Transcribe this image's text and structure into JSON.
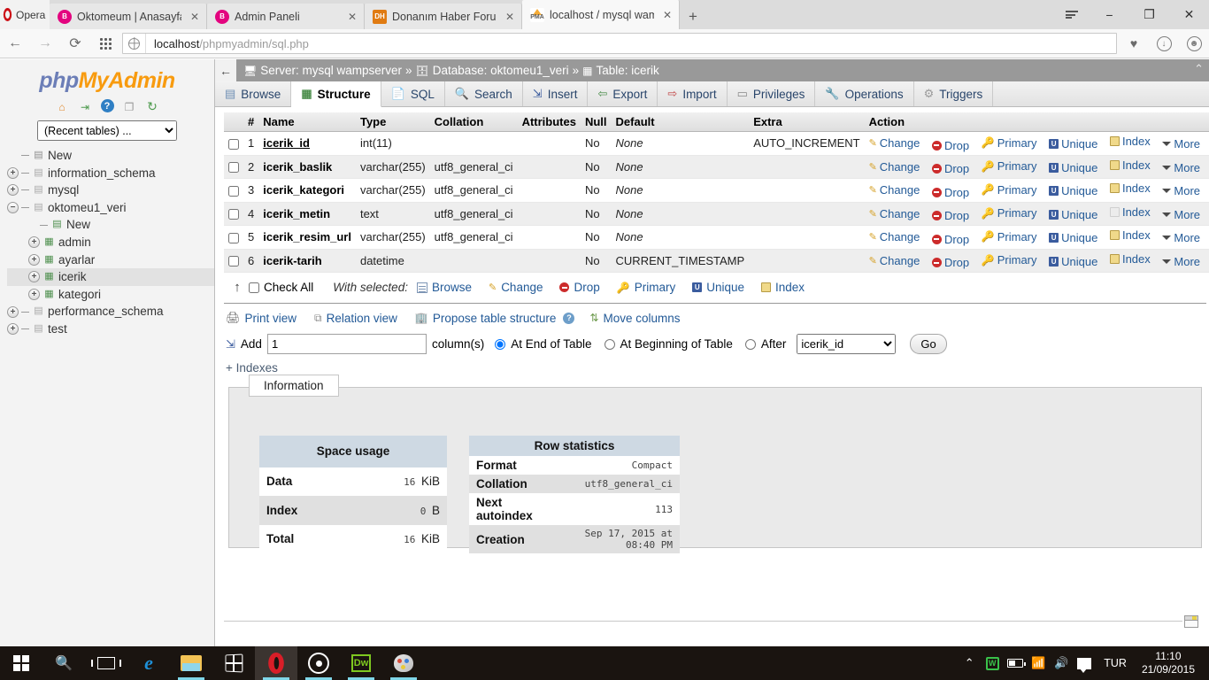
{
  "browser": {
    "brand": "Opera",
    "tabs": [
      {
        "title": "Oktomeum | Anasayfa",
        "favicon": "opera-blogger-icon",
        "active": false
      },
      {
        "title": "Admin Paneli",
        "favicon": "opera-blogger-icon",
        "active": false
      },
      {
        "title": "Donanım Haber Forum",
        "favicon": "donanim-haber-icon",
        "active": false
      },
      {
        "title": "localhost / mysql wampse",
        "favicon": "phpmyadmin-icon",
        "active": true
      }
    ],
    "new_tab_label": "+",
    "window_controls": {
      "minimize": "−",
      "maximize": "❐",
      "close": "✕"
    },
    "url_prefix": "localhost",
    "url_suffix": "/phpmyadmin/sql.php"
  },
  "sidebar": {
    "logo": {
      "php": "php",
      "my": "My",
      "admin": "Admin"
    },
    "icons": [
      {
        "name": "home-icon",
        "glyph": "⌂"
      },
      {
        "name": "logout-icon",
        "glyph": "⇥"
      },
      {
        "name": "help-icon",
        "glyph": "?"
      },
      {
        "name": "docs-icon",
        "glyph": "❐"
      },
      {
        "name": "reload-icon",
        "glyph": "↻"
      }
    ],
    "recent_select": "(Recent tables) ...",
    "tree": [
      {
        "label": "New",
        "level": 0,
        "expander": "",
        "icon": "new-db-icon",
        "selected": false
      },
      {
        "label": "information_schema",
        "level": 0,
        "expander": "+",
        "icon": "db-icon",
        "selected": false
      },
      {
        "label": "mysql",
        "level": 0,
        "expander": "+",
        "icon": "db-icon",
        "selected": false
      },
      {
        "label": "oktomeu1_veri",
        "level": 0,
        "expander": "−",
        "icon": "db-icon",
        "selected": false
      },
      {
        "label": "New",
        "level": 1,
        "expander": "",
        "icon": "new-table-icon",
        "selected": false
      },
      {
        "label": "admin",
        "level": 1,
        "expander": "+",
        "icon": "table-icon",
        "selected": false
      },
      {
        "label": "ayarlar",
        "level": 1,
        "expander": "+",
        "icon": "table-icon",
        "selected": false
      },
      {
        "label": "icerik",
        "level": 1,
        "expander": "+",
        "icon": "table-icon",
        "selected": true
      },
      {
        "label": "kategori",
        "level": 1,
        "expander": "+",
        "icon": "table-icon",
        "selected": false
      },
      {
        "label": "performance_schema",
        "level": 0,
        "expander": "+",
        "icon": "db-icon",
        "selected": false
      },
      {
        "label": "test",
        "level": 0,
        "expander": "+",
        "icon": "db-icon",
        "selected": false
      }
    ]
  },
  "breadcrumb": {
    "back": "←",
    "server_label": "Server: mysql wampserver",
    "sep": "»",
    "database_label": "Database: oktomeu1_veri",
    "table_label": "Table: icerik",
    "collapse": "⌃"
  },
  "main_tabs": [
    {
      "label": "Browse",
      "icon": "browse-icon",
      "active": false
    },
    {
      "label": "Structure",
      "icon": "structure-icon",
      "active": true
    },
    {
      "label": "SQL",
      "icon": "sql-icon",
      "active": false
    },
    {
      "label": "Search",
      "icon": "search-icon",
      "active": false
    },
    {
      "label": "Insert",
      "icon": "insert-icon",
      "active": false
    },
    {
      "label": "Export",
      "icon": "export-icon",
      "active": false
    },
    {
      "label": "Import",
      "icon": "import-icon",
      "active": false
    },
    {
      "label": "Privileges",
      "icon": "privileges-icon",
      "active": false
    },
    {
      "label": "Operations",
      "icon": "operations-icon",
      "active": false
    },
    {
      "label": "Triggers",
      "icon": "triggers-icon",
      "active": false
    }
  ],
  "structure_table": {
    "headers": [
      "#",
      "Name",
      "Type",
      "Collation",
      "Attributes",
      "Null",
      "Default",
      "Extra",
      "Action"
    ],
    "action_labels": [
      "Change",
      "Drop",
      "Primary",
      "Unique",
      "Index",
      "More"
    ],
    "rows": [
      {
        "num": "1",
        "name": "icerik_id",
        "primary": true,
        "type": "int(11)",
        "collation": "",
        "attributes": "",
        "null": "No",
        "default": "None",
        "extra": "AUTO_INCREMENT"
      },
      {
        "num": "2",
        "name": "icerik_baslik",
        "primary": false,
        "type": "varchar(255)",
        "collation": "utf8_general_ci",
        "attributes": "",
        "null": "No",
        "default": "None",
        "extra": ""
      },
      {
        "num": "3",
        "name": "icerik_kategori",
        "primary": false,
        "type": "varchar(255)",
        "collation": "utf8_general_ci",
        "attributes": "",
        "null": "No",
        "default": "None",
        "extra": ""
      },
      {
        "num": "4",
        "name": "icerik_metin",
        "primary": false,
        "type": "text",
        "collation": "utf8_general_ci",
        "attributes": "",
        "null": "No",
        "default": "None",
        "extra": ""
      },
      {
        "num": "5",
        "name": "icerik_resim_url",
        "primary": false,
        "type": "varchar(255)",
        "collation": "utf8_general_ci",
        "attributes": "",
        "null": "No",
        "default": "None",
        "extra": ""
      },
      {
        "num": "6",
        "name": "icerik-tarih",
        "primary": false,
        "type": "datetime",
        "collation": "",
        "attributes": "",
        "null": "No",
        "default": "CURRENT_TIMESTAMP",
        "extra": ""
      }
    ]
  },
  "with_selected": {
    "check_all": "Check All",
    "label": "With selected:",
    "items": [
      "Browse",
      "Change",
      "Drop",
      "Primary",
      "Unique",
      "Index"
    ]
  },
  "link_row": {
    "print_view": "Print view",
    "relation_view": "Relation view",
    "propose_table_structure": "Propose table structure",
    "move_columns": "Move columns"
  },
  "add_row": {
    "add_label": "Add",
    "count_value": "1",
    "columns_label": "column(s)",
    "at_end": "At End of Table",
    "at_beginning": "At Beginning of Table",
    "after": "After",
    "after_select_value": "icerik_id",
    "go": "Go",
    "selected_position": "at_end"
  },
  "indexes_link": "+ Indexes",
  "information": {
    "legend": "Information",
    "space_usage": {
      "caption": "Space usage",
      "rows": [
        {
          "key": "Data",
          "value": "16",
          "unit": "KiB"
        },
        {
          "key": "Index",
          "value": "0",
          "unit": "B"
        },
        {
          "key": "Total",
          "value": "16",
          "unit": "KiB"
        }
      ]
    },
    "row_statistics": {
      "caption": "Row statistics",
      "rows": [
        {
          "key": "Format",
          "value": "Compact"
        },
        {
          "key": "Collation",
          "value": "utf8_general_ci"
        },
        {
          "key": "Next autoindex",
          "value": "113"
        },
        {
          "key": "Creation",
          "value": "Sep 17, 2015 at 08:40 PM"
        }
      ]
    }
  },
  "taskbar": {
    "items": [
      {
        "name": "start-button",
        "icon": "windows-logo-icon",
        "running": false,
        "active": false
      },
      {
        "name": "search-button",
        "icon": "search-icon",
        "running": false,
        "active": false
      },
      {
        "name": "task-view-button",
        "icon": "task-view-icon",
        "running": false,
        "active": false
      },
      {
        "name": "edge-button",
        "icon": "edge-icon",
        "running": false,
        "active": false
      },
      {
        "name": "explorer-button",
        "icon": "folder-icon",
        "running": true,
        "active": false
      },
      {
        "name": "store-button",
        "icon": "store-icon",
        "running": false,
        "active": false
      },
      {
        "name": "opera-button",
        "icon": "opera-icon",
        "running": true,
        "active": true
      },
      {
        "name": "orbit-button",
        "icon": "orbit-icon",
        "running": true,
        "active": false
      },
      {
        "name": "dreamweaver-button",
        "icon": "dreamweaver-icon",
        "running": true,
        "active": false
      },
      {
        "name": "paint-button",
        "icon": "paint-icon",
        "running": true,
        "active": false
      }
    ],
    "tray": {
      "show_hidden": "⌃",
      "wamp": "W",
      "language": "TUR",
      "time": "11:10",
      "date": "21/09/2015"
    }
  }
}
